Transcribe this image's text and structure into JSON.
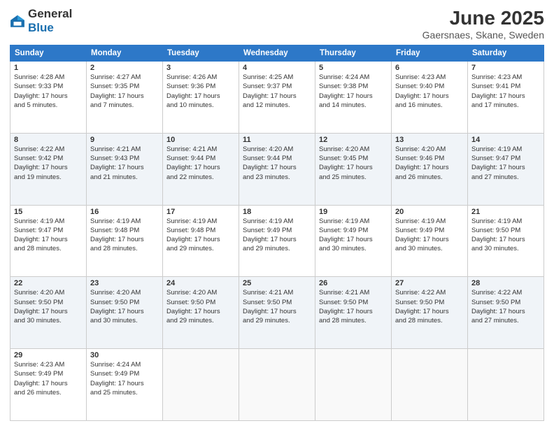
{
  "header": {
    "logo_general": "General",
    "logo_blue": "Blue",
    "title": "June 2025",
    "subtitle": "Gaersnaes, Skane, Sweden"
  },
  "days_of_week": [
    "Sunday",
    "Monday",
    "Tuesday",
    "Wednesday",
    "Thursday",
    "Friday",
    "Saturday"
  ],
  "weeks": [
    [
      {
        "day": "1",
        "sunrise": "4:28 AM",
        "sunset": "9:33 PM",
        "daylight": "17 hours and 5 minutes."
      },
      {
        "day": "2",
        "sunrise": "4:27 AM",
        "sunset": "9:35 PM",
        "daylight": "17 hours and 7 minutes."
      },
      {
        "day": "3",
        "sunrise": "4:26 AM",
        "sunset": "9:36 PM",
        "daylight": "17 hours and 10 minutes."
      },
      {
        "day": "4",
        "sunrise": "4:25 AM",
        "sunset": "9:37 PM",
        "daylight": "17 hours and 12 minutes."
      },
      {
        "day": "5",
        "sunrise": "4:24 AM",
        "sunset": "9:38 PM",
        "daylight": "17 hours and 14 minutes."
      },
      {
        "day": "6",
        "sunrise": "4:23 AM",
        "sunset": "9:40 PM",
        "daylight": "17 hours and 16 minutes."
      },
      {
        "day": "7",
        "sunrise": "4:23 AM",
        "sunset": "9:41 PM",
        "daylight": "17 hours and 17 minutes."
      }
    ],
    [
      {
        "day": "8",
        "sunrise": "4:22 AM",
        "sunset": "9:42 PM",
        "daylight": "17 hours and 19 minutes."
      },
      {
        "day": "9",
        "sunrise": "4:21 AM",
        "sunset": "9:43 PM",
        "daylight": "17 hours and 21 minutes."
      },
      {
        "day": "10",
        "sunrise": "4:21 AM",
        "sunset": "9:44 PM",
        "daylight": "17 hours and 22 minutes."
      },
      {
        "day": "11",
        "sunrise": "4:20 AM",
        "sunset": "9:44 PM",
        "daylight": "17 hours and 23 minutes."
      },
      {
        "day": "12",
        "sunrise": "4:20 AM",
        "sunset": "9:45 PM",
        "daylight": "17 hours and 25 minutes."
      },
      {
        "day": "13",
        "sunrise": "4:20 AM",
        "sunset": "9:46 PM",
        "daylight": "17 hours and 26 minutes."
      },
      {
        "day": "14",
        "sunrise": "4:19 AM",
        "sunset": "9:47 PM",
        "daylight": "17 hours and 27 minutes."
      }
    ],
    [
      {
        "day": "15",
        "sunrise": "4:19 AM",
        "sunset": "9:47 PM",
        "daylight": "17 hours and 28 minutes."
      },
      {
        "day": "16",
        "sunrise": "4:19 AM",
        "sunset": "9:48 PM",
        "daylight": "17 hours and 28 minutes."
      },
      {
        "day": "17",
        "sunrise": "4:19 AM",
        "sunset": "9:48 PM",
        "daylight": "17 hours and 29 minutes."
      },
      {
        "day": "18",
        "sunrise": "4:19 AM",
        "sunset": "9:49 PM",
        "daylight": "17 hours and 29 minutes."
      },
      {
        "day": "19",
        "sunrise": "4:19 AM",
        "sunset": "9:49 PM",
        "daylight": "17 hours and 30 minutes."
      },
      {
        "day": "20",
        "sunrise": "4:19 AM",
        "sunset": "9:49 PM",
        "daylight": "17 hours and 30 minutes."
      },
      {
        "day": "21",
        "sunrise": "4:19 AM",
        "sunset": "9:50 PM",
        "daylight": "17 hours and 30 minutes."
      }
    ],
    [
      {
        "day": "22",
        "sunrise": "4:20 AM",
        "sunset": "9:50 PM",
        "daylight": "17 hours and 30 minutes."
      },
      {
        "day": "23",
        "sunrise": "4:20 AM",
        "sunset": "9:50 PM",
        "daylight": "17 hours and 30 minutes."
      },
      {
        "day": "24",
        "sunrise": "4:20 AM",
        "sunset": "9:50 PM",
        "daylight": "17 hours and 29 minutes."
      },
      {
        "day": "25",
        "sunrise": "4:21 AM",
        "sunset": "9:50 PM",
        "daylight": "17 hours and 29 minutes."
      },
      {
        "day": "26",
        "sunrise": "4:21 AM",
        "sunset": "9:50 PM",
        "daylight": "17 hours and 28 minutes."
      },
      {
        "day": "27",
        "sunrise": "4:22 AM",
        "sunset": "9:50 PM",
        "daylight": "17 hours and 28 minutes."
      },
      {
        "day": "28",
        "sunrise": "4:22 AM",
        "sunset": "9:50 PM",
        "daylight": "17 hours and 27 minutes."
      }
    ],
    [
      {
        "day": "29",
        "sunrise": "4:23 AM",
        "sunset": "9:49 PM",
        "daylight": "17 hours and 26 minutes."
      },
      {
        "day": "30",
        "sunrise": "4:24 AM",
        "sunset": "9:49 PM",
        "daylight": "17 hours and 25 minutes."
      },
      null,
      null,
      null,
      null,
      null
    ]
  ],
  "labels": {
    "sunrise": "Sunrise:",
    "sunset": "Sunset:",
    "daylight": "Daylight:"
  }
}
